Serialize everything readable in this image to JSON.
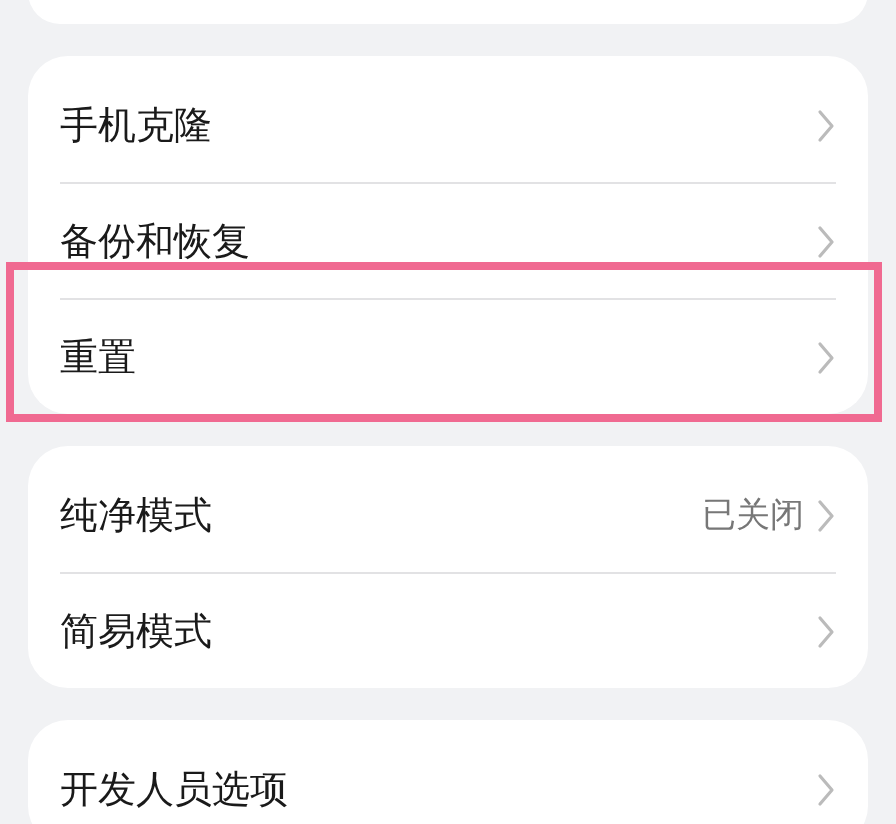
{
  "groups": [
    {
      "items": [
        {
          "label": "手机克隆",
          "highlighted": false
        },
        {
          "label": "备份和恢复",
          "highlighted": false
        },
        {
          "label": "重置",
          "highlighted": true
        }
      ]
    },
    {
      "items": [
        {
          "label": "纯净模式",
          "value": "已关闭",
          "highlighted": false
        },
        {
          "label": "简易模式",
          "highlighted": false
        }
      ]
    },
    {
      "items": [
        {
          "label": "开发人员选项"
        }
      ]
    }
  ]
}
